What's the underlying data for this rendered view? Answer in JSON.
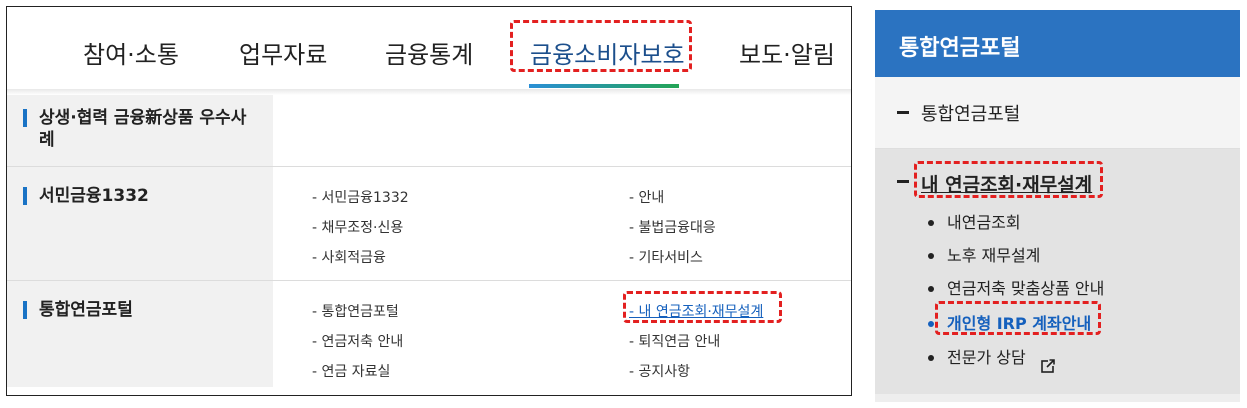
{
  "nav": {
    "items": [
      {
        "label": "참여·소통"
      },
      {
        "label": "업무자료"
      },
      {
        "label": "금융통계"
      },
      {
        "label": "금융소비자보호"
      },
      {
        "label": "보도·알림"
      }
    ]
  },
  "rows": [
    {
      "title": "상생·협력 금융新상품 우수사례",
      "links": []
    },
    {
      "title": "서민금융1332",
      "links": [
        "- 서민금융1332",
        "- 안내",
        "- 채무조정·신용",
        "- 불법금융대응",
        "- 사회적금융",
        "- 기타서비스"
      ]
    },
    {
      "title": "통합연금포털",
      "links": [
        "- 통합연금포털",
        "- 내 연금조회·재무설계",
        "- 연금저축 안내",
        "- 퇴직연금 안내",
        "- 연금 자료실",
        "- 공지사항"
      ]
    }
  ],
  "side": {
    "header": "통합연금포털",
    "top_item": "통합연금포털",
    "section": "내 연금조회·재무설계",
    "sub_items": [
      "내연금조회",
      "노후 재무설계",
      "연금저축 맞춤상품 안내",
      "개인형 IRP 계좌안내",
      "전문가 상담"
    ]
  },
  "colors": {
    "accent_blue": "#2b73c1",
    "link_blue": "#1560bd",
    "highlight_red": "#e32020",
    "underline_green": "#23a455"
  },
  "icons": {
    "external": "external-link-icon"
  }
}
